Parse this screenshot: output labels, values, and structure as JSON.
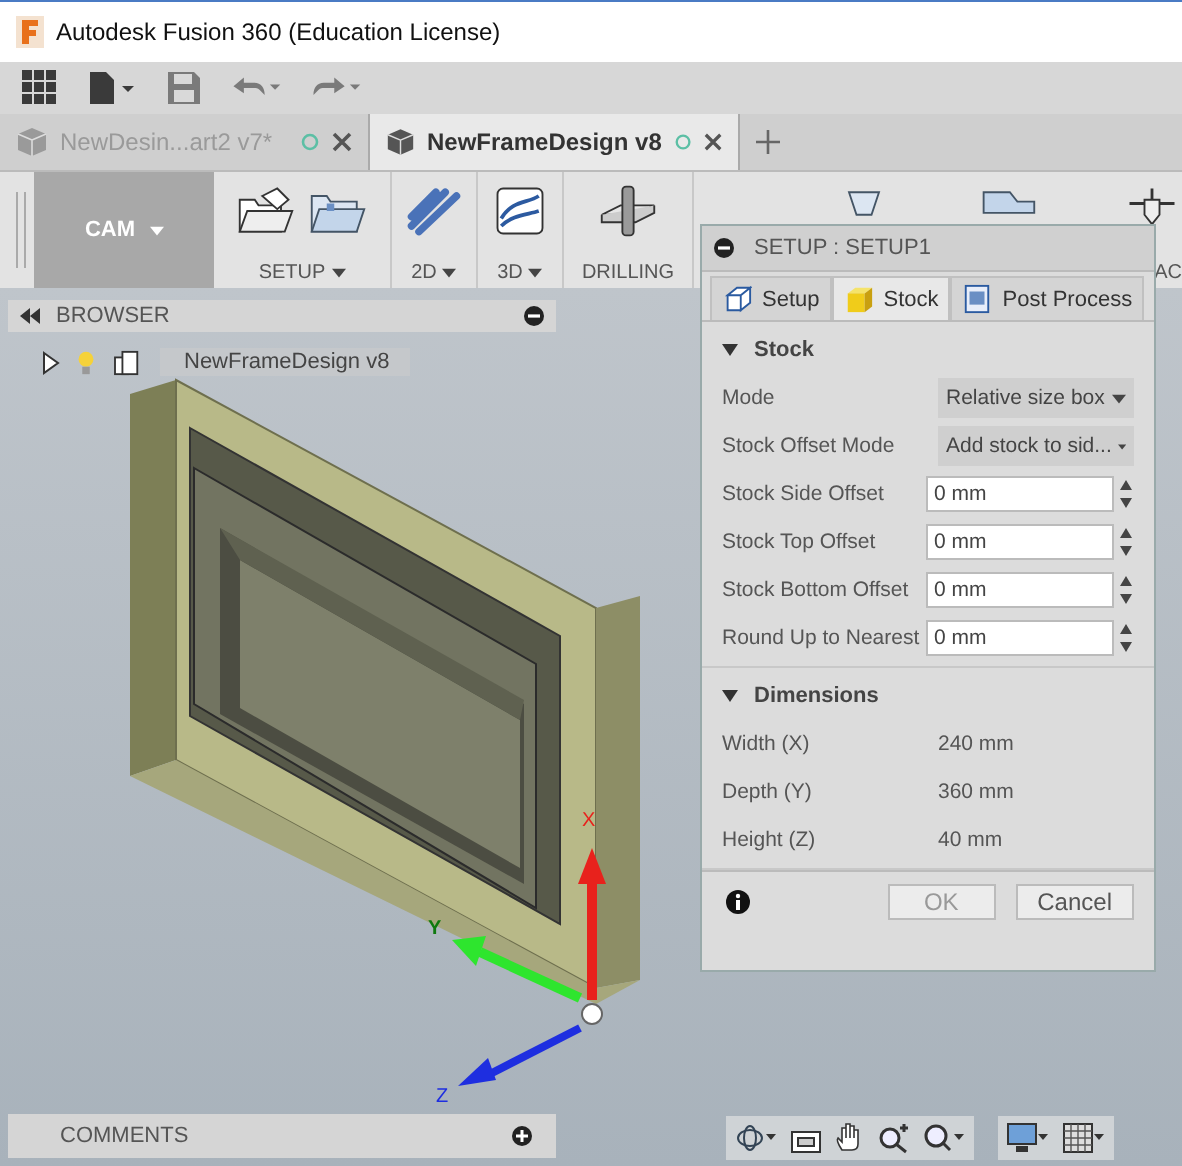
{
  "window": {
    "title": "Autodesk Fusion 360 (Education License)"
  },
  "document_tabs": [
    {
      "label": "NewDesin...art2 v7*",
      "selected": false
    },
    {
      "label": "NewFrameDesign v8",
      "selected": true
    }
  ],
  "ribbon": {
    "workspace": {
      "label": "CAM",
      "dropdown": true
    },
    "groups": [
      {
        "label": "SETUP",
        "dropdown": true,
        "kind": "setup"
      },
      {
        "label": "2D",
        "dropdown": true,
        "kind": "planar"
      },
      {
        "label": "3D",
        "dropdown": true,
        "kind": "surface"
      },
      {
        "label": "DRILLING",
        "dropdown": false,
        "kind": "drill"
      },
      {
        "label": "AC",
        "dropdown": false,
        "kind": "more"
      }
    ]
  },
  "browser": {
    "title": "BROWSER",
    "items": [
      {
        "label": "NewFrameDesign v8",
        "expanded": false
      }
    ]
  },
  "viewport": {
    "axes": {
      "x": "X",
      "y": "Y",
      "z": "Z"
    }
  },
  "dialog": {
    "title": "SETUP : SETUP1",
    "tabs": [
      {
        "label": "Setup",
        "selected": false,
        "kind": "setup"
      },
      {
        "label": "Stock",
        "selected": true,
        "kind": "stock"
      },
      {
        "label": "Post Process",
        "selected": false,
        "kind": "post"
      }
    ],
    "sections": [
      {
        "title": "Stock",
        "expanded": true,
        "rows": [
          {
            "kind": "dropdown",
            "label": "Mode",
            "value": "Relative size box"
          },
          {
            "kind": "dropdown",
            "label": "Stock Offset Mode",
            "value": "Add stock to sid..."
          },
          {
            "kind": "spinner",
            "label": "Stock Side Offset",
            "value": "0 mm"
          },
          {
            "kind": "spinner",
            "label": "Stock Top Offset",
            "value": "0 mm"
          },
          {
            "kind": "spinner",
            "label": "Stock Bottom Offset",
            "value": "0 mm"
          },
          {
            "kind": "spinner",
            "label": "Round Up to Nearest",
            "value": "0 mm"
          }
        ]
      },
      {
        "title": "Dimensions",
        "expanded": true,
        "rows": [
          {
            "kind": "readout",
            "label": "Width (X)",
            "value": "240 mm"
          },
          {
            "kind": "readout",
            "label": "Depth (Y)",
            "value": "360 mm"
          },
          {
            "kind": "readout",
            "label": "Height (Z)",
            "value": "40 mm"
          }
        ]
      }
    ],
    "buttons": [
      {
        "label": "OK",
        "disabled": true
      },
      {
        "label": "Cancel",
        "disabled": false
      }
    ]
  },
  "comments": {
    "title": "COMMENTS"
  }
}
